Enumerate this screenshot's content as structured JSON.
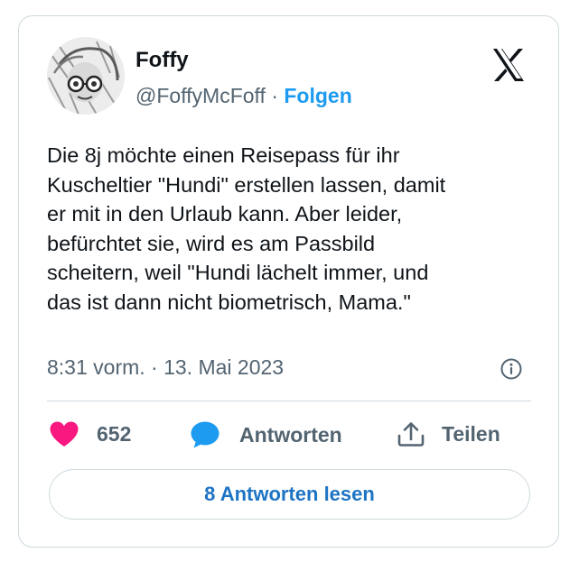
{
  "author": {
    "name": "Foffy",
    "handle": "@FoffyMcFoff",
    "separator": "·",
    "follow_label": "Folgen"
  },
  "tweet": {
    "lines": [
      "Die 8j möchte einen Reisepass für ihr",
      "Kuscheltier \"Hundi\" erstellen lassen, damit",
      "er mit in den Urlaub kann. Aber leider,",
      "befürchtet sie, wird es am Passbild",
      "scheitern, weil \"Hundi lächelt immer, und",
      "das ist dann nicht biometrisch, Mama.\""
    ],
    "timestamp": "8:31 vorm. · 13. Mai 2023"
  },
  "actions": {
    "like_count": "652",
    "reply_label": "Antworten",
    "share_label": "Teilen"
  },
  "read_replies_label": "8 Antworten lesen",
  "icons": {
    "brand": "x-logo-icon",
    "info": "info-icon",
    "like": "heart-icon",
    "reply": "speech-bubble-icon",
    "share": "share-upload-icon"
  },
  "colors": {
    "link": "#1d9bf0",
    "heart": "#f91880",
    "text": "#0f1419",
    "muted": "#536471",
    "border": "#cfd9de"
  }
}
